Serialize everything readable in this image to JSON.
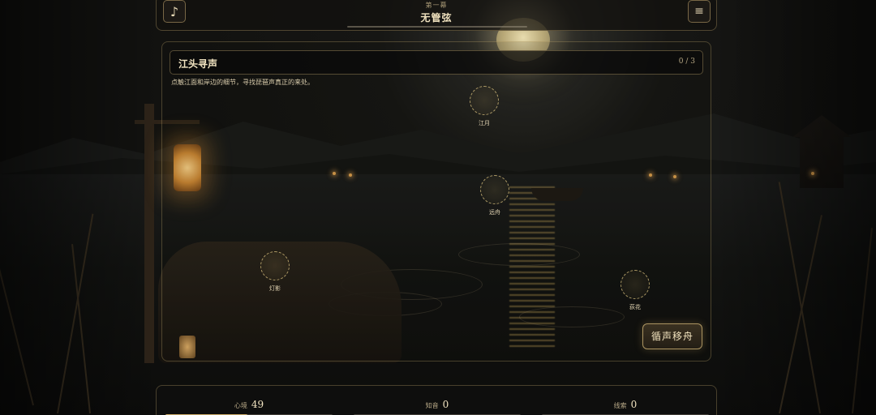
{
  "header": {
    "act_label": "第一幕",
    "act_title": "无管弦",
    "music_icon": "♪",
    "menu_icon": "≡"
  },
  "task": {
    "title": "江头寻声",
    "progress_text": "0 / 3",
    "description": "点触江面和岸边的细节，寻找琵琶声真正的来处。"
  },
  "hotspots": [
    {
      "label": "江月"
    },
    {
      "label": "远舟"
    },
    {
      "label": "灯影"
    },
    {
      "label": "荻花"
    }
  ],
  "action_button": {
    "label": "循声移舟"
  },
  "stats": [
    {
      "label": "心境",
      "value": "49",
      "fill": 0.49
    },
    {
      "label": "知音",
      "value": "0",
      "fill": 0
    },
    {
      "label": "线索",
      "value": "0",
      "fill": 0
    }
  ],
  "colors": {
    "accent_gold": "#c9a866",
    "text_cream": "#f2e4c1",
    "panel_border": "#c4aa70",
    "background": "#0f0f0d"
  }
}
